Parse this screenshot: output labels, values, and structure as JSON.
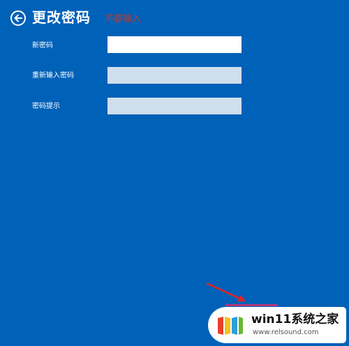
{
  "header": {
    "title": "更改密码",
    "annotation": "不要输入"
  },
  "form": {
    "fields": [
      {
        "label": "新密码",
        "value": ""
      },
      {
        "label": "重新输入密码",
        "value": ""
      },
      {
        "label": "密码提示",
        "value": ""
      }
    ]
  },
  "watermark": {
    "title": "win11系统之家",
    "url": "www.relsound.com"
  },
  "colors": {
    "background": "#0061b8",
    "annotation": "#c0392b",
    "arrow": "#e02424",
    "next_button_border": "#b5367a"
  }
}
